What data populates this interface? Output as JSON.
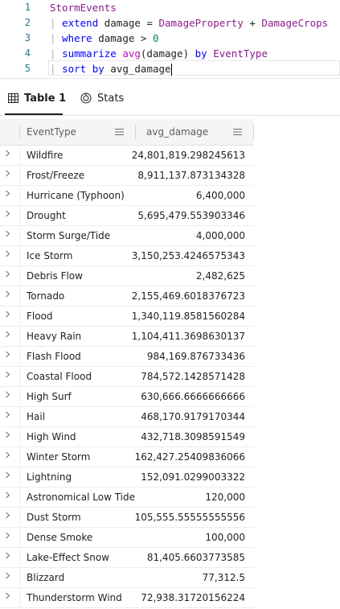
{
  "editor": {
    "lines": [
      {
        "num": "1",
        "tokens": [
          {
            "t": "StormEvents",
            "c": "tbl"
          }
        ]
      },
      {
        "num": "2",
        "tokens": [
          {
            "t": "| ",
            "c": "pipe"
          },
          {
            "t": "extend",
            "c": "kw"
          },
          {
            "t": " damage = ",
            "c": "id"
          },
          {
            "t": "DamageProperty",
            "c": "tbl"
          },
          {
            "t": " + ",
            "c": "id"
          },
          {
            "t": "DamageCrops",
            "c": "tbl"
          }
        ]
      },
      {
        "num": "3",
        "tokens": [
          {
            "t": "| ",
            "c": "pipe"
          },
          {
            "t": "where",
            "c": "kw"
          },
          {
            "t": " damage > ",
            "c": "id"
          },
          {
            "t": "0",
            "c": "num"
          }
        ]
      },
      {
        "num": "4",
        "tokens": [
          {
            "t": "| ",
            "c": "pipe"
          },
          {
            "t": "summarize",
            "c": "kw"
          },
          {
            "t": " ",
            "c": "id"
          },
          {
            "t": "avg",
            "c": "fn"
          },
          {
            "t": "(damage) ",
            "c": "id"
          },
          {
            "t": "by",
            "c": "kw"
          },
          {
            "t": " ",
            "c": "id"
          },
          {
            "t": "EventType",
            "c": "tbl"
          }
        ]
      },
      {
        "num": "5",
        "tokens": [
          {
            "t": "| ",
            "c": "pipe"
          },
          {
            "t": "sort",
            "c": "kw"
          },
          {
            "t": " ",
            "c": "id"
          },
          {
            "t": "by",
            "c": "kw"
          },
          {
            "t": " avg_damage",
            "c": "id"
          }
        ]
      }
    ]
  },
  "tabs": {
    "table_label": "Table 1",
    "stats_label": "Stats",
    "table_icon": "table-icon",
    "stats_icon": "stats-icon"
  },
  "grid": {
    "columns": [
      "EventType",
      "avg_damage"
    ],
    "column_menu_icon": "column-menu-icon",
    "expander_icon": "chevron-right-icon",
    "rows": [
      {
        "event": "Wildfire",
        "avg": "24,801,819.298245613"
      },
      {
        "event": "Frost/Freeze",
        "avg": "8,911,137.873134328"
      },
      {
        "event": "Hurricane (Typhoon)",
        "avg": "6,400,000"
      },
      {
        "event": "Drought",
        "avg": "5,695,479.553903346"
      },
      {
        "event": "Storm Surge/Tide",
        "avg": "4,000,000"
      },
      {
        "event": "Ice Storm",
        "avg": "3,150,253.4246575343"
      },
      {
        "event": "Debris Flow",
        "avg": "2,482,625"
      },
      {
        "event": "Tornado",
        "avg": "2,155,469.6018376723"
      },
      {
        "event": "Flood",
        "avg": "1,340,119.8581560284"
      },
      {
        "event": "Heavy Rain",
        "avg": "1,104,411.3698630137"
      },
      {
        "event": "Flash Flood",
        "avg": "984,169.876733436"
      },
      {
        "event": "Coastal Flood",
        "avg": "784,572.1428571428"
      },
      {
        "event": "High Surf",
        "avg": "630,666.6666666666"
      },
      {
        "event": "Hail",
        "avg": "468,170.9179170344"
      },
      {
        "event": "High Wind",
        "avg": "432,718.3098591549"
      },
      {
        "event": "Winter Storm",
        "avg": "162,427.25409836066"
      },
      {
        "event": "Lightning",
        "avg": "152,091.0299003322"
      },
      {
        "event": "Astronomical Low Tide",
        "avg": "120,000"
      },
      {
        "event": "Dust Storm",
        "avg": "105,555.55555555556"
      },
      {
        "event": "Dense Smoke",
        "avg": "100,000"
      },
      {
        "event": "Lake-Effect Snow",
        "avg": "81,405.6603773585"
      },
      {
        "event": "Blizzard",
        "avg": "77,312.5"
      },
      {
        "event": "Thunderstorm Wind",
        "avg": "72,938.31720156224"
      }
    ]
  }
}
